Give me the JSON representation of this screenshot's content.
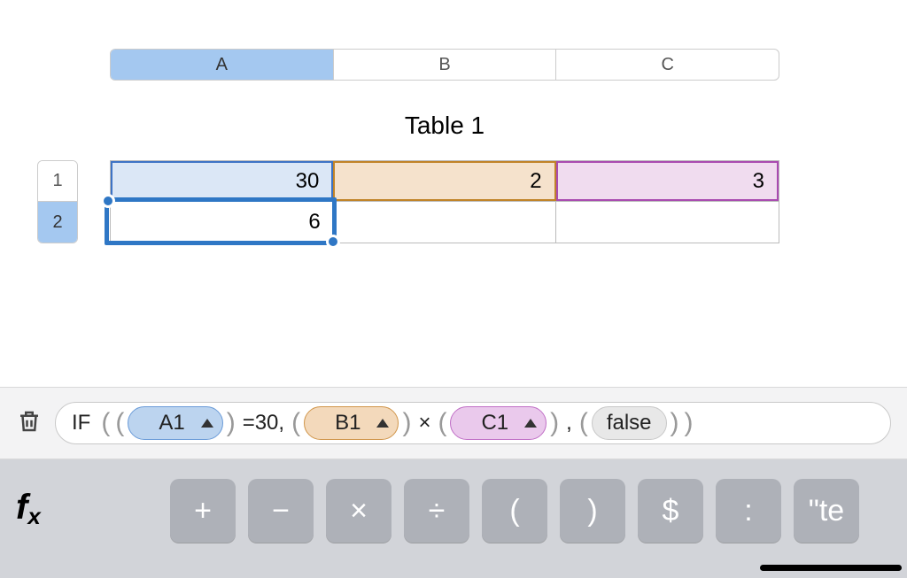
{
  "columns": [
    "A",
    "B",
    "C"
  ],
  "rows": [
    "1",
    "2"
  ],
  "table_title": "Table 1",
  "cells": {
    "r1c1": "30",
    "r1c2": "2",
    "r1c3": "3",
    "r2c1": "6",
    "r2c2": "",
    "r2c3": ""
  },
  "formula": {
    "func": "IF",
    "ref_a": "A1",
    "eq_text": "=30,",
    "ref_b": "B1",
    "times": "×",
    "ref_c": "C1",
    "comma": ",",
    "false_pill": "false",
    "trailing": "\"te"
  },
  "keypad": {
    "fx": "fx",
    "keys": [
      "+",
      "−",
      "×",
      "÷",
      "(",
      ")",
      "$",
      ":"
    ],
    "quote_key": "\"te"
  }
}
